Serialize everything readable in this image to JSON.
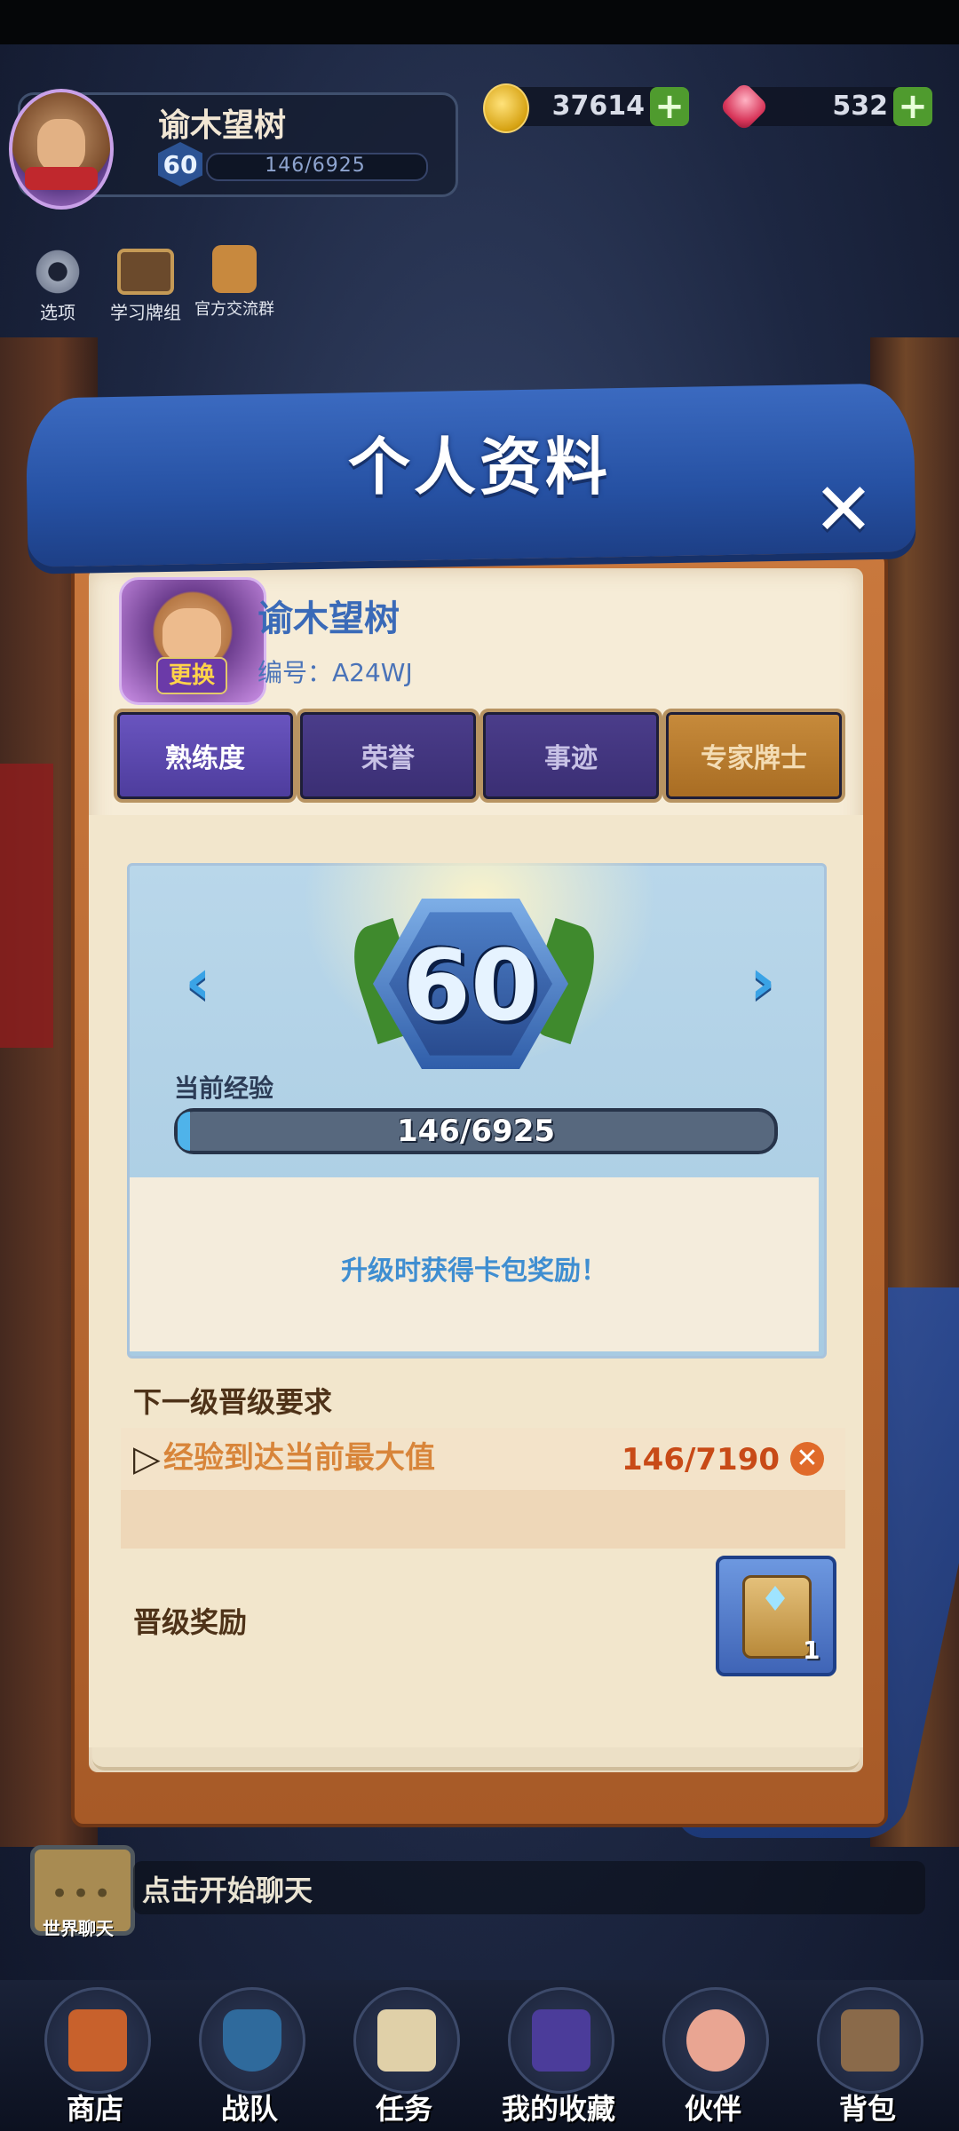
{
  "header": {
    "player_name": "谕木望树",
    "level": "60",
    "xp": "146/6925",
    "coins": "37614",
    "gems": "532",
    "plus_symbol": "+"
  },
  "quick_buttons": {
    "options": "选项",
    "study_deck": "学习牌组",
    "community": "官方交流群"
  },
  "dialog": {
    "title": "个人资料",
    "close_symbol": "✕",
    "profile_name": "谕木望树",
    "profile_id": "编号：A24WJ",
    "change_avatar": "更换",
    "tabs": [
      {
        "label": "熟练度",
        "active": true
      },
      {
        "label": "荣誉",
        "active": false
      },
      {
        "label": "事迹",
        "active": false
      },
      {
        "label": "专家牌士",
        "active": false
      }
    ],
    "level_card": {
      "prev_symbol": "‹",
      "next_symbol": "›",
      "level": "60",
      "current_xp_label": "当前经验",
      "xp_text": "146/6925",
      "xp_fraction": 0.021,
      "reward_hint": "升级时获得卡包奖励！"
    },
    "next_level": {
      "title": "下一级晋级要求",
      "requirement": "经验到达当前最大值",
      "progress": "146/7190",
      "status": "✕"
    },
    "promotion_reward": {
      "label": "晋级奖励",
      "count": "1"
    }
  },
  "chat": {
    "icon_label": "世界聊天",
    "placeholder": "点击开始聊天"
  },
  "nav": [
    {
      "label": "商店"
    },
    {
      "label": "战队"
    },
    {
      "label": "任务"
    },
    {
      "label": "我的收藏"
    },
    {
      "label": "伙伴"
    },
    {
      "label": "背包"
    }
  ],
  "colors": {
    "banner_blue": "#2651a3",
    "active_tab": "#6a55c0",
    "expert_tab": "#c78b3c",
    "requirement_orange": "#d8853a",
    "progress_red": "#c84a17"
  }
}
